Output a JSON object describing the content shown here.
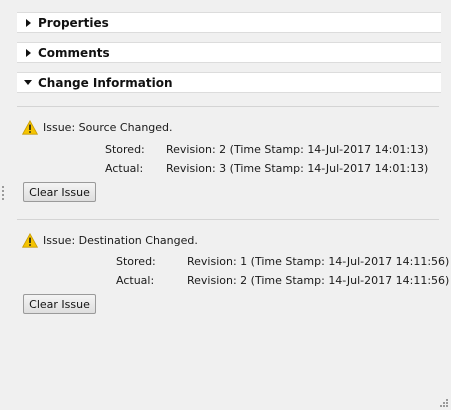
{
  "sections": {
    "properties": {
      "label": "Properties",
      "expanded": false
    },
    "comments": {
      "label": "Comments",
      "expanded": false
    },
    "change_information": {
      "label": "Change Information",
      "expanded": true
    }
  },
  "issues": [
    {
      "title": "Issue: Source Changed.",
      "stored_label": "Stored:",
      "stored_value": "Revision: 2 (Time Stamp: 14-Jul-2017 14:01:13)",
      "actual_label": "Actual:",
      "actual_value": "Revision: 3 (Time Stamp: 14-Jul-2017 14:01:13)",
      "button_label": "Clear Issue",
      "icon": "warning-icon"
    },
    {
      "title": "Issue: Destination Changed.",
      "stored_label": "Stored:",
      "stored_value": "Revision: 1 (Time Stamp: 14-Jul-2017 14:11:56)",
      "actual_label": "Actual:",
      "actual_value": "Revision: 2 (Time Stamp: 14-Jul-2017 14:11:56)",
      "button_label": "Clear Issue",
      "icon": "warning-icon"
    }
  ],
  "colors": {
    "warning": "#f5c400",
    "background": "#f0f0f0"
  }
}
